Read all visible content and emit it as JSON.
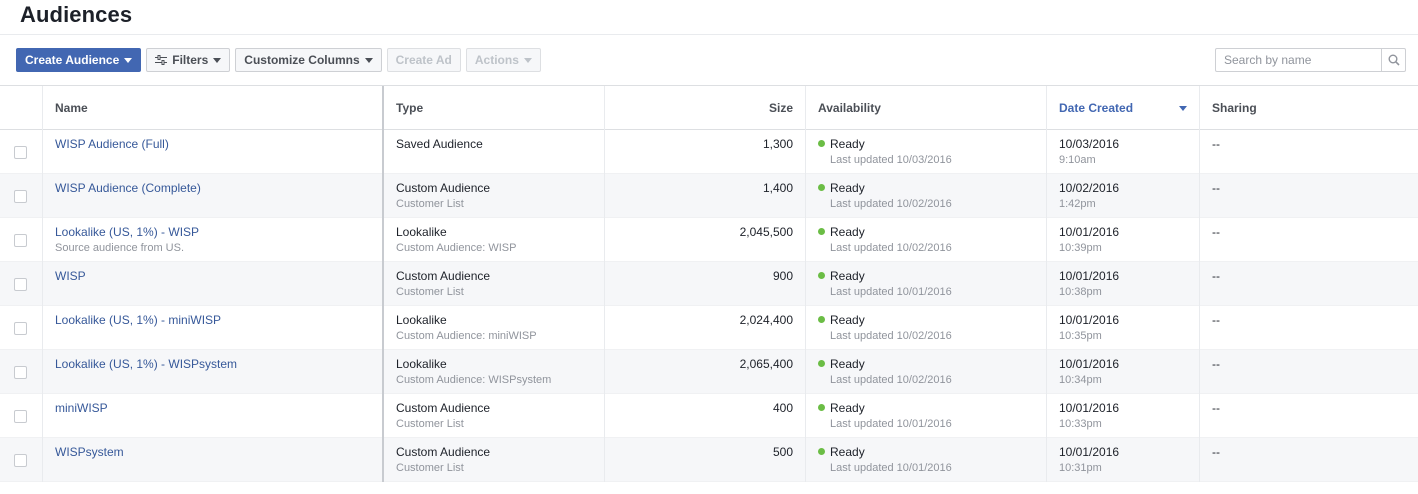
{
  "page": {
    "title": "Audiences"
  },
  "toolbar": {
    "create_audience": "Create Audience",
    "filters": "Filters",
    "customize_columns": "Customize Columns",
    "create_ad": "Create Ad",
    "actions": "Actions"
  },
  "search": {
    "placeholder": "Search by name",
    "value": ""
  },
  "colors": {
    "accent": "#4267b2",
    "link": "#365899",
    "ready": "#6bbd45"
  },
  "columns": {
    "name": "Name",
    "type": "Type",
    "size": "Size",
    "availability": "Availability",
    "date_created": "Date Created",
    "sharing": "Sharing"
  },
  "rows": [
    {
      "name": "WISP Audience (Full)",
      "name_sub": "",
      "type": "Saved Audience",
      "type_sub": "",
      "size": "1,300",
      "status": "Ready",
      "updated": "Last updated 10/03/2016",
      "date": "10/03/2016",
      "time": "9:10am",
      "sharing": "--"
    },
    {
      "name": "WISP Audience (Complete)",
      "name_sub": "",
      "type": "Custom Audience",
      "type_sub": "Customer List",
      "size": "1,400",
      "status": "Ready",
      "updated": "Last updated 10/02/2016",
      "date": "10/02/2016",
      "time": "1:42pm",
      "sharing": "--"
    },
    {
      "name": "Lookalike (US, 1%) - WISP",
      "name_sub": "Source audience from US.",
      "type": "Lookalike",
      "type_sub": "Custom Audience: WISP",
      "size": "2,045,500",
      "status": "Ready",
      "updated": "Last updated 10/02/2016",
      "date": "10/01/2016",
      "time": "10:39pm",
      "sharing": "--"
    },
    {
      "name": "WISP",
      "name_sub": "",
      "type": "Custom Audience",
      "type_sub": "Customer List",
      "size": "900",
      "status": "Ready",
      "updated": "Last updated 10/01/2016",
      "date": "10/01/2016",
      "time": "10:38pm",
      "sharing": "--"
    },
    {
      "name": "Lookalike (US, 1%) - miniWISP",
      "name_sub": "",
      "type": "Lookalike",
      "type_sub": "Custom Audience: miniWISP",
      "size": "2,024,400",
      "status": "Ready",
      "updated": "Last updated 10/02/2016",
      "date": "10/01/2016",
      "time": "10:35pm",
      "sharing": "--"
    },
    {
      "name": "Lookalike (US, 1%) - WISPsystem",
      "name_sub": "",
      "type": "Lookalike",
      "type_sub": "Custom Audience: WISPsystem",
      "size": "2,065,400",
      "status": "Ready",
      "updated": "Last updated 10/02/2016",
      "date": "10/01/2016",
      "time": "10:34pm",
      "sharing": "--"
    },
    {
      "name": "miniWISP",
      "name_sub": "",
      "type": "Custom Audience",
      "type_sub": "Customer List",
      "size": "400",
      "status": "Ready",
      "updated": "Last updated 10/01/2016",
      "date": "10/01/2016",
      "time": "10:33pm",
      "sharing": "--"
    },
    {
      "name": "WISPsystem",
      "name_sub": "",
      "type": "Custom Audience",
      "type_sub": "Customer List",
      "size": "500",
      "status": "Ready",
      "updated": "Last updated 10/01/2016",
      "date": "10/01/2016",
      "time": "10:31pm",
      "sharing": "--"
    }
  ]
}
